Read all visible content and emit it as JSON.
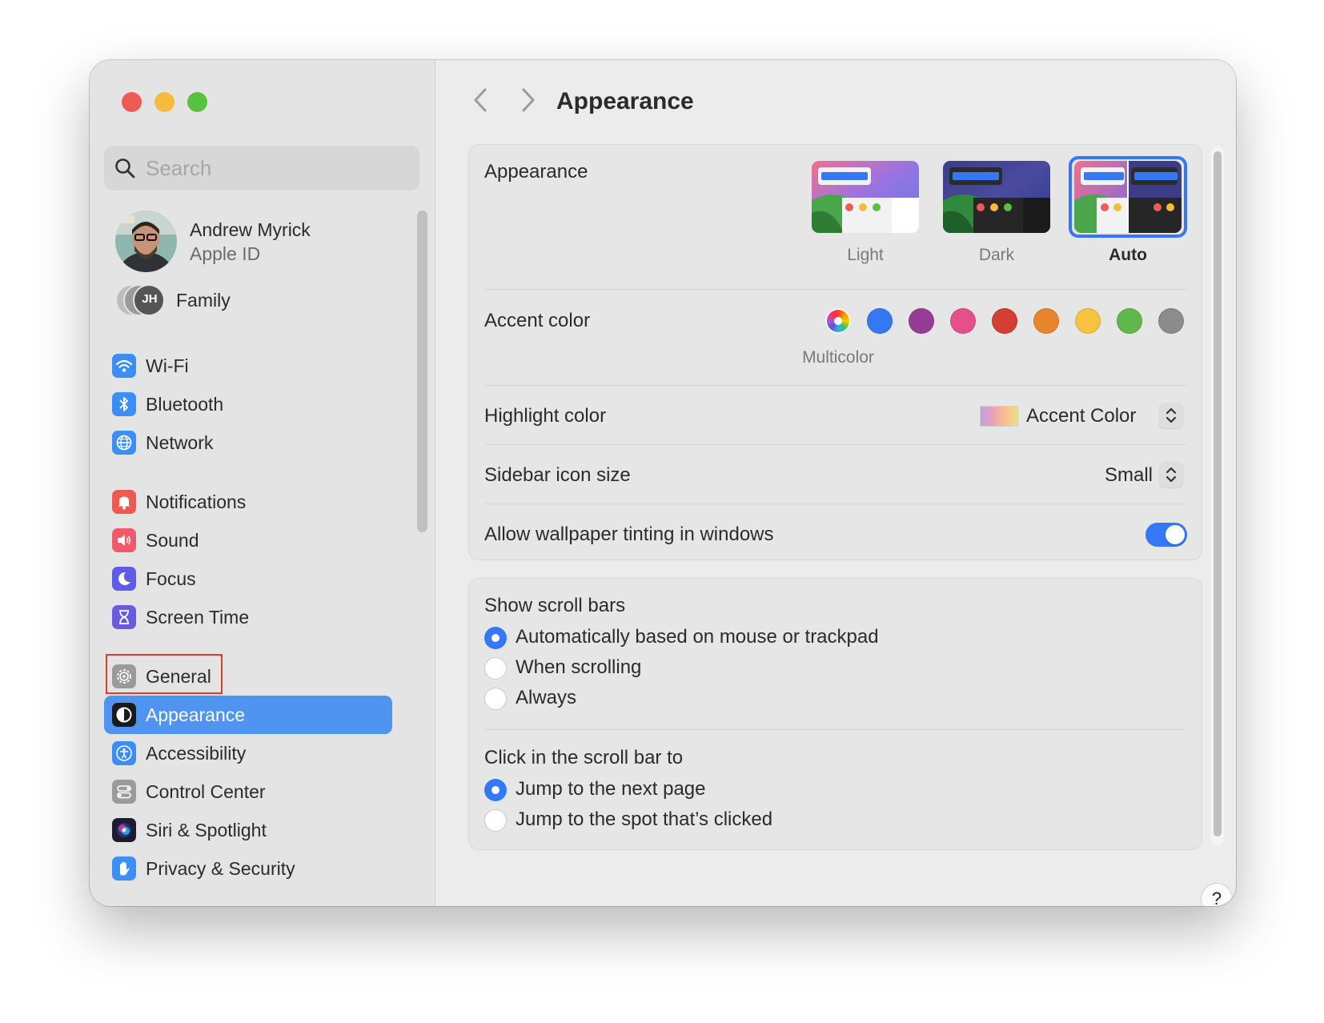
{
  "search": {
    "placeholder": "Search"
  },
  "profile": {
    "name": "Andrew Myrick",
    "subtitle": "Apple ID"
  },
  "family": {
    "label": "Family",
    "initials": "JH"
  },
  "sidebar": {
    "items": [
      {
        "label": "Wi-Fi"
      },
      {
        "label": "Bluetooth"
      },
      {
        "label": "Network"
      },
      {
        "label": "Notifications"
      },
      {
        "label": "Sound"
      },
      {
        "label": "Focus"
      },
      {
        "label": "Screen Time"
      },
      {
        "label": "General"
      },
      {
        "label": "Appearance"
      },
      {
        "label": "Accessibility"
      },
      {
        "label": "Control Center"
      },
      {
        "label": "Siri & Spotlight"
      },
      {
        "label": "Privacy & Security"
      }
    ]
  },
  "main": {
    "title": "Appearance",
    "appearance": {
      "label": "Appearance",
      "options": [
        {
          "label": "Light"
        },
        {
          "label": "Dark"
        },
        {
          "label": "Auto"
        }
      ],
      "selected": "Auto"
    },
    "accent": {
      "label": "Accent color",
      "selected_label": "Multicolor",
      "colors": [
        "#3478f6",
        "#953d96",
        "#e6508a",
        "#d43e33",
        "#e8852c",
        "#f7c33e",
        "#60b84a",
        "#8c8c8c"
      ]
    },
    "highlight": {
      "label": "Highlight color",
      "value": "Accent Color"
    },
    "icon_size": {
      "label": "Sidebar icon size",
      "value": "Small"
    },
    "tinting": {
      "label": "Allow wallpaper tinting in windows",
      "enabled": true
    },
    "scrollbars": {
      "label": "Show scroll bars",
      "options": [
        {
          "label": "Automatically based on mouse or trackpad",
          "selected": true
        },
        {
          "label": "When scrolling",
          "selected": false
        },
        {
          "label": "Always",
          "selected": false
        }
      ]
    },
    "click": {
      "label": "Click in the scroll bar to",
      "options": [
        {
          "label": "Jump to the next page",
          "selected": true
        },
        {
          "label": "Jump to the spot that’s clicked",
          "selected": false
        }
      ]
    },
    "help_label": "?"
  },
  "colors": {
    "accent": "#3478f6",
    "selection": "#4f94f1",
    "annotation": "#e23a32"
  }
}
